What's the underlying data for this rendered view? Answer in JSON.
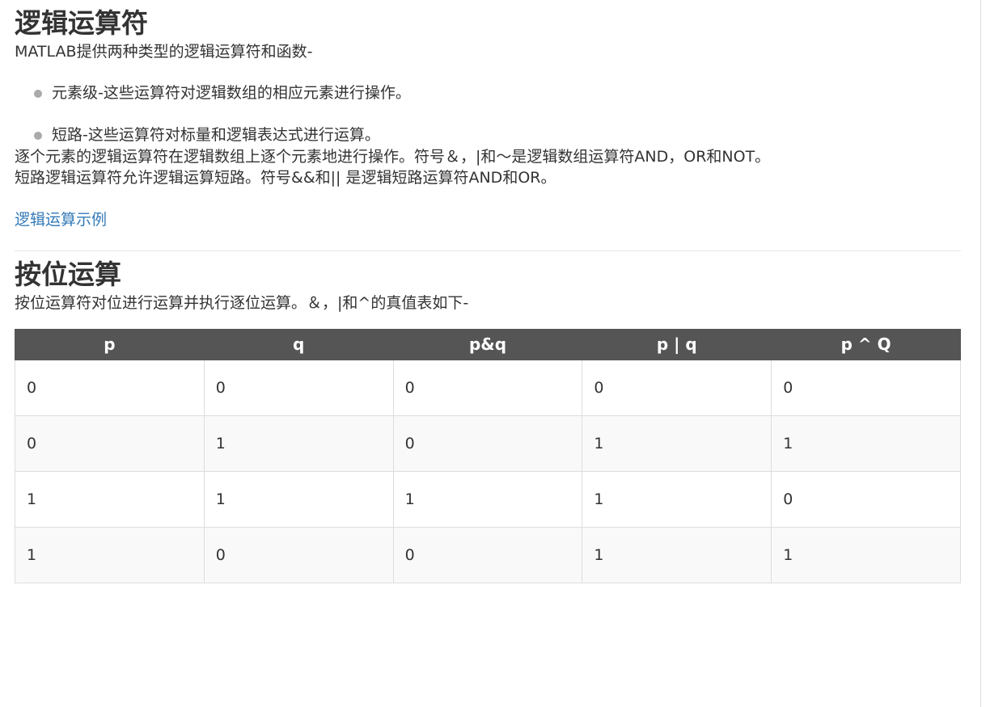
{
  "logical": {
    "title": "逻辑运算符",
    "intro": "MATLAB提供两种类型的逻辑运算符和函数-",
    "bullets": [
      "元素级-这些运算符对逻辑数组的相应元素进行操作。",
      "短路-这些运算符对标量和逻辑表达式进行运算。"
    ],
    "elementwise": "逐个元素的逻辑运算符在逻辑数组上逐个元素地进行操作。符号＆，|和〜是逻辑数组运算符AND，OR和NOT。",
    "shortcircuit": "短路逻辑运算符允许逻辑运算短路。符号&&和|| 是逻辑短路运算符AND和OR。",
    "example_link": "逻辑运算示例"
  },
  "bitwise": {
    "title": "按位运算",
    "intro": "按位运算符对位进行运算并执行逐位运算。＆，|和^的真值表如下-",
    "table": {
      "headers": [
        "p",
        "q",
        "p&q",
        "p | q",
        "p ^ Q"
      ],
      "rows": [
        [
          "0",
          "0",
          "0",
          "0",
          "0"
        ],
        [
          "0",
          "1",
          "0",
          "1",
          "1"
        ],
        [
          "1",
          "1",
          "1",
          "1",
          "0"
        ],
        [
          "1",
          "0",
          "0",
          "1",
          "1"
        ]
      ]
    }
  },
  "colors": {
    "link": "#337ab7",
    "table_header_bg": "#555555",
    "stripe_bg": "#f9f9f9"
  }
}
